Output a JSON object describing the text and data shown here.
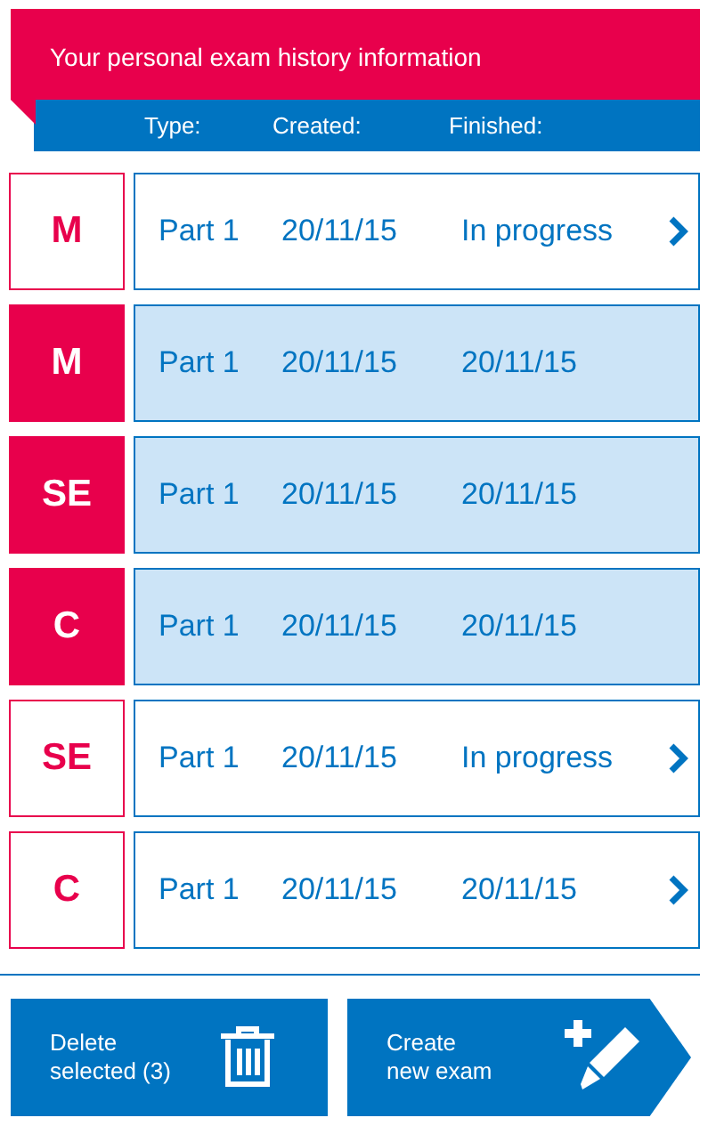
{
  "header": {
    "title": "Your personal exam history information",
    "columns": [
      "Type:",
      "Created:",
      "Finished:"
    ]
  },
  "exams": [
    {
      "type": "M",
      "part": "Part 1",
      "created": "20/11/15",
      "finished": "In progress",
      "selected": false
    },
    {
      "type": "M",
      "part": "Part 1",
      "created": "20/11/15",
      "finished": "20/11/15",
      "selected": true
    },
    {
      "type": "SE",
      "part": "Part 1",
      "created": "20/11/15",
      "finished": "20/11/15",
      "selected": true
    },
    {
      "type": "C",
      "part": "Part 1",
      "created": "20/11/15",
      "finished": "20/11/15",
      "selected": true
    },
    {
      "type": "SE",
      "part": "Part 1",
      "created": "20/11/15",
      "finished": "In progress",
      "selected": false
    },
    {
      "type": "C",
      "part": "Part 1",
      "created": "20/11/15",
      "finished": "20/11/15",
      "selected": false
    }
  ],
  "buttons": [
    {
      "kind": "delete",
      "label_lines": [
        "Delete",
        "selected (3)"
      ]
    },
    {
      "kind": "create",
      "label_lines": [
        "Create",
        "new exam"
      ]
    }
  ]
}
